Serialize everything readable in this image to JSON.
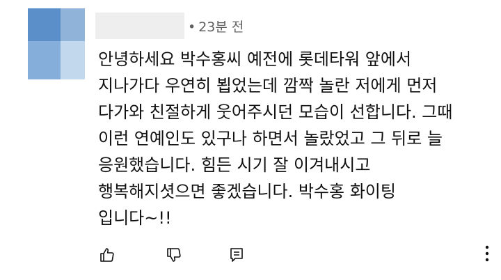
{
  "comment": {
    "author_redacted": true,
    "time": "23분 전",
    "lines": [
      "안녕하세요 박수홍씨 예전에 롯데타워 앞에서",
      "지나가다 우연히 뵙었는데 깜짝 놀란 저에게 먼저",
      "다가와 친절하게 웃어주시던 모습이 선합니다. 그때",
      "이런 연예인도 있구나 하면서 놀랐었고 그 뒤로 늘",
      "응원했습니다. 힘든 시기 잘 이겨내시고",
      "행복해지셧으면 좋겠습니다. 박수홍 화이팅",
      "입니다~!!"
    ]
  },
  "actions": {
    "like_icon": "thumbs-up-icon",
    "dislike_icon": "thumbs-down-icon",
    "reply_icon": "reply-icon",
    "more_icon": "more-vertical-icon"
  },
  "colors": {
    "text": "#111111",
    "meta": "#606060",
    "avatar": [
      "#5b8fc9",
      "#8fb3d9",
      "#86aedb",
      "#c2d8ec"
    ]
  }
}
